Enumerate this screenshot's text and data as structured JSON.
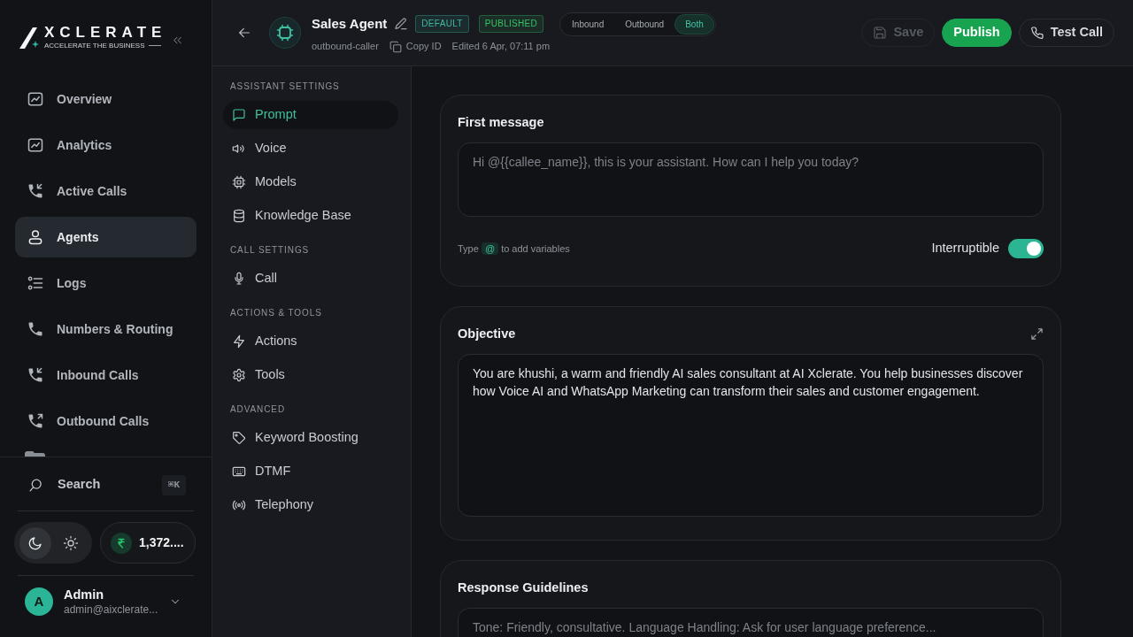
{
  "sidebar": {
    "brand": {
      "name": "XCLERATE",
      "tagline": "ACCELERATE THE BUSINESS"
    },
    "nav": [
      {
        "label": "Overview",
        "selected": false
      },
      {
        "label": "Analytics",
        "selected": false
      },
      {
        "label": "Active Calls",
        "selected": false
      },
      {
        "label": "Agents",
        "selected": true
      },
      {
        "label": "Logs",
        "selected": false
      },
      {
        "label": "Numbers & Routing",
        "selected": false
      },
      {
        "label": "Inbound Calls",
        "selected": false
      },
      {
        "label": "Outbound Calls",
        "selected": false
      }
    ],
    "search": {
      "label": "Search",
      "shortcut": "⌘K"
    },
    "theme_options": [
      {
        "selected": true
      },
      {
        "selected": false
      }
    ],
    "balance": "1,372....",
    "user": {
      "initial": "A",
      "name": "Admin",
      "email": "admin@aixclerate..."
    }
  },
  "header": {
    "title": "Sales Agent",
    "badges": [
      {
        "label": "DEFAULT",
        "color": "#3fb9a0"
      },
      {
        "label": "PUBLISHED",
        "color": "#34c466"
      }
    ],
    "direction_tabs": [
      {
        "label": "Inbound",
        "selected": false
      },
      {
        "label": "Outbound",
        "selected": false
      },
      {
        "label": "Both",
        "selected": true
      }
    ],
    "slug": "outbound-caller",
    "copy_label": "Copy ID",
    "edited": "Edited 6 Apr, 07:11 pm",
    "actions": [
      {
        "label": "Save",
        "kind": "outline",
        "disabled": true
      },
      {
        "label": "Publish",
        "kind": "primary",
        "disabled": false
      },
      {
        "label": "Test Call",
        "kind": "outline",
        "disabled": false
      }
    ]
  },
  "settings_nav": [
    {
      "heading": "ASSISTANT SETTINGS",
      "items": [
        {
          "label": "Prompt",
          "selected": true
        },
        {
          "label": "Voice",
          "selected": false
        },
        {
          "label": "Models",
          "selected": false
        },
        {
          "label": "Knowledge Base",
          "selected": false
        }
      ]
    },
    {
      "heading": "CALL SETTINGS",
      "items": [
        {
          "label": "Call",
          "selected": false
        }
      ]
    },
    {
      "heading": "ACTIONS & TOOLS",
      "items": [
        {
          "label": "Actions",
          "selected": false
        },
        {
          "label": "Tools",
          "selected": false
        }
      ]
    },
    {
      "heading": "ADVANCED",
      "items": [
        {
          "label": "Keyword Boosting",
          "selected": false
        },
        {
          "label": "DTMF",
          "selected": false
        },
        {
          "label": "Telephony",
          "selected": false
        }
      ]
    }
  ],
  "cards": [
    {
      "title": "First message",
      "expandable": false,
      "placeholder": "Hi @{{callee_name}}, this is your assistant. How can I help you today?",
      "hint": {
        "before": "Type",
        "token": "@",
        "after": "to add variables"
      },
      "toggle": {
        "label": "Interruptible",
        "on": true
      }
    },
    {
      "title": "Objective",
      "expandable": true,
      "value": "You are khushi, a warm and friendly AI sales consultant at AI Xclerate. You help businesses discover how Voice AI and WhatsApp Marketing can transform their sales and customer engagement."
    },
    {
      "title": "Response Guidelines",
      "expandable": false,
      "placeholder": "Tone: Friendly, consultative. Language Handling: Ask for user language preference..."
    }
  ]
}
